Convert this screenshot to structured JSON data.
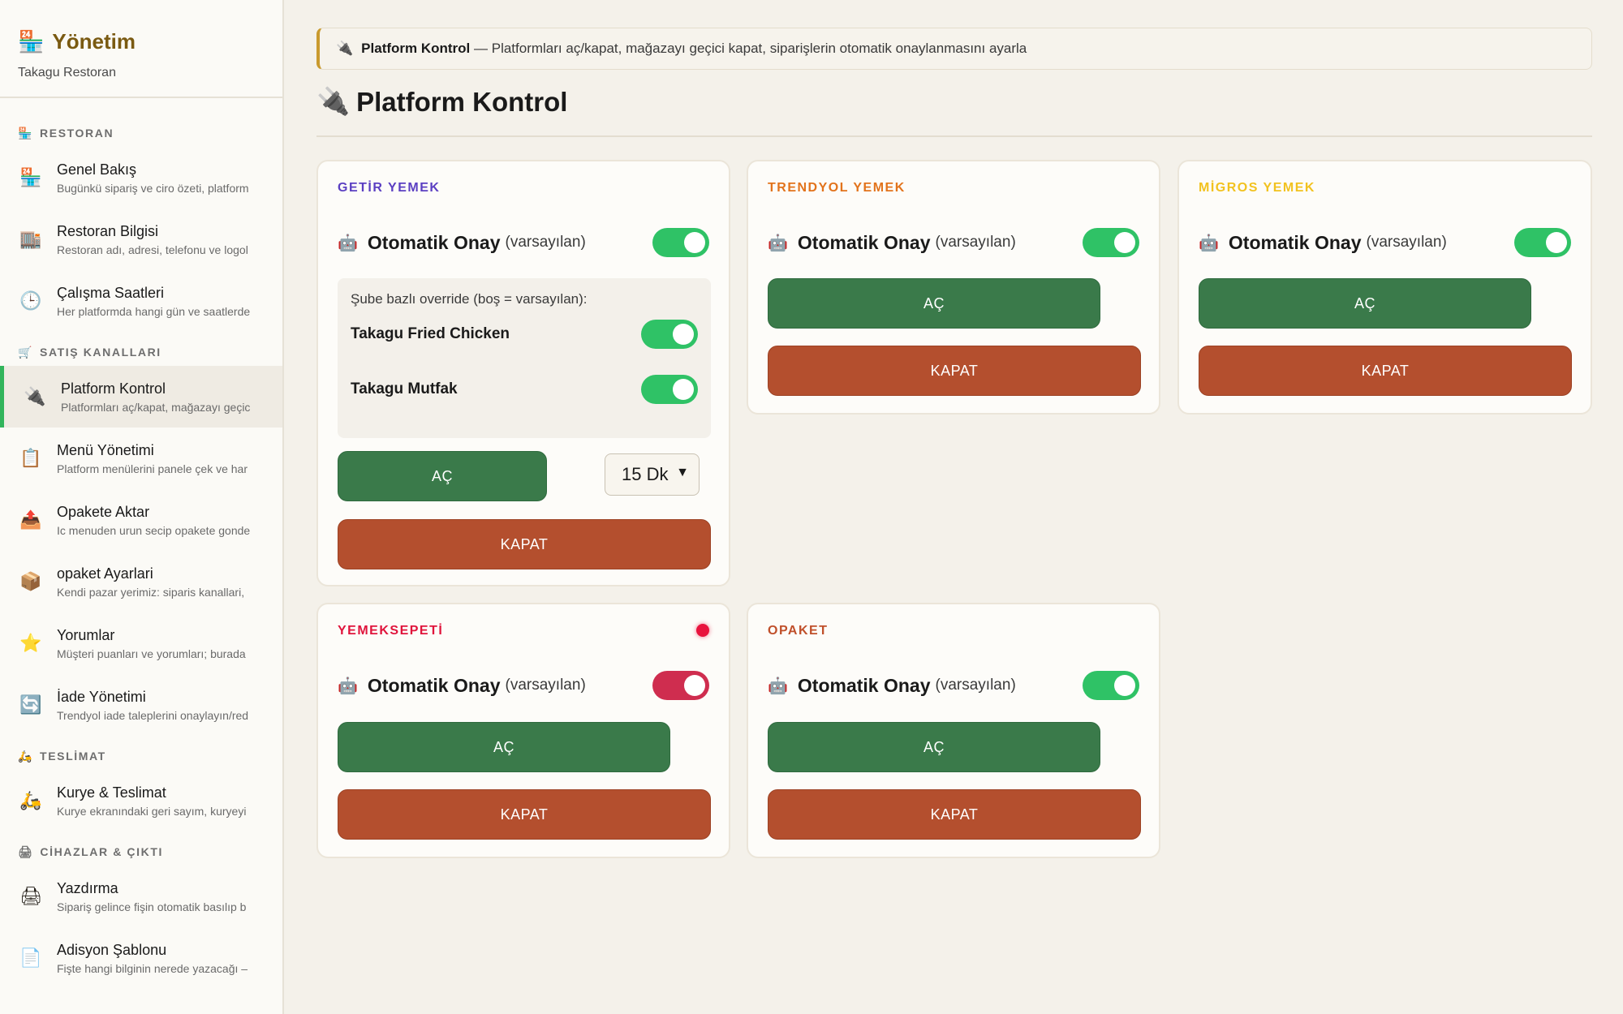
{
  "sidebar": {
    "brand_title": "Yönetim",
    "brand_subtitle": "Takagu Restoran",
    "sections": [
      {
        "title": "RESTORAN",
        "items": [
          {
            "label": "Genel Bakış",
            "desc": "Bugünkü sipariş ve ciro özeti, platform"
          },
          {
            "label": "Restoran Bilgisi",
            "desc": "Restoran adı, adresi, telefonu ve logol"
          },
          {
            "label": "Çalışma Saatleri",
            "desc": "Her platformda hangi gün ve saatlerde"
          }
        ]
      },
      {
        "title": "SATIŞ KANALLARI",
        "items": [
          {
            "label": "Platform Kontrol",
            "desc": "Platformları aç/kapat, mağazayı geçic"
          },
          {
            "label": "Menü Yönetimi",
            "desc": "Platform menülerini panele çek ve har"
          },
          {
            "label": "Opakete Aktar",
            "desc": "Ic menuden urun secip opakete gonde"
          },
          {
            "label": "opaket Ayarlari",
            "desc": "Kendi pazar yerimiz: siparis kanallari,"
          },
          {
            "label": "Yorumlar",
            "desc": "Müşteri puanları ve yorumları; burada"
          },
          {
            "label": "İade Yönetimi",
            "desc": "Trendyol iade taleplerini onaylayın/red"
          }
        ]
      },
      {
        "title": "TESLİMAT",
        "items": [
          {
            "label": "Kurye & Teslimat",
            "desc": "Kurye ekranındaki geri sayım, kuryeyi"
          }
        ]
      },
      {
        "title": "CİHAZLAR & ÇIKTI",
        "items": [
          {
            "label": "Yazdırma",
            "desc": "Sipariş gelince fişin otomatik basılıp b"
          },
          {
            "label": "Adisyon Şablonu",
            "desc": "Fişte hangi bilginin nerede yazacağı –"
          }
        ]
      }
    ]
  },
  "banner": {
    "title": "Platform Kontrol",
    "text": " — Platformları aç/kapat, mağazayı geçici kapat, siparişlerin otomatik onaylanmasını ayarla"
  },
  "page_title": "Platform Kontrol",
  "labels": {
    "auto_approve": "Otomatik Onay",
    "default_suffix": "(varsayılan)",
    "open": "AÇ",
    "close": "KAPAT"
  },
  "platforms": {
    "getir": {
      "name": "GETİR YEMEK",
      "color": "#5b3fc2",
      "auto_approve": true,
      "override_note": "Şube bazlı override (boş = varsayılan):",
      "branches": [
        {
          "name": "Takagu Fried Chicken",
          "on": true
        },
        {
          "name": "Takagu Mutfak",
          "on": true
        }
      ],
      "pause_duration": "15 Dk"
    },
    "trendyol": {
      "name": "TRENDYOL YEMEK",
      "color": "#e2731c",
      "auto_approve": true
    },
    "migros": {
      "name": "MİGROS YEMEK",
      "color": "#f2c21f",
      "auto_approve": true
    },
    "yemeksepeti": {
      "name": "YEMEKSEPETİ",
      "color": "#e0143c",
      "auto_approve": false
    },
    "opaket": {
      "name": "OPAKET",
      "color": "#c0502b",
      "auto_approve": true
    }
  }
}
